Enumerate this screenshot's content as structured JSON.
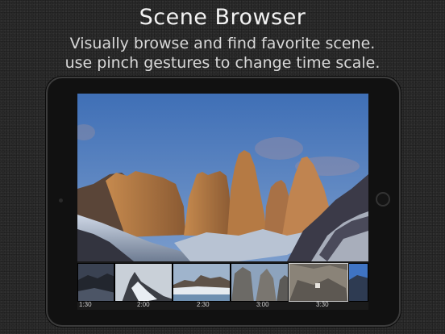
{
  "header": {
    "title": "Scene Browser",
    "subtitle_line1": "Visually browse and find favorite scene.",
    "subtitle_line2": "use pinch gestures to change time scale."
  },
  "player": {
    "scene": "mountain peaks at dusk"
  },
  "filmstrip": {
    "time_labels": [
      "1:30",
      "2:00",
      "2:30",
      "3:00",
      "3:30"
    ],
    "thumbnails": [
      {
        "name": "dark mountain"
      },
      {
        "name": "snowy ridge"
      },
      {
        "name": "snow landscape with lake"
      },
      {
        "name": "rock towers"
      },
      {
        "name": "climber on rock"
      },
      {
        "name": "blue sky cliff"
      }
    ]
  },
  "colors": {
    "background": "#2a2a2a",
    "tablet_bezel": "#111111",
    "sky": "#4a76b8"
  }
}
